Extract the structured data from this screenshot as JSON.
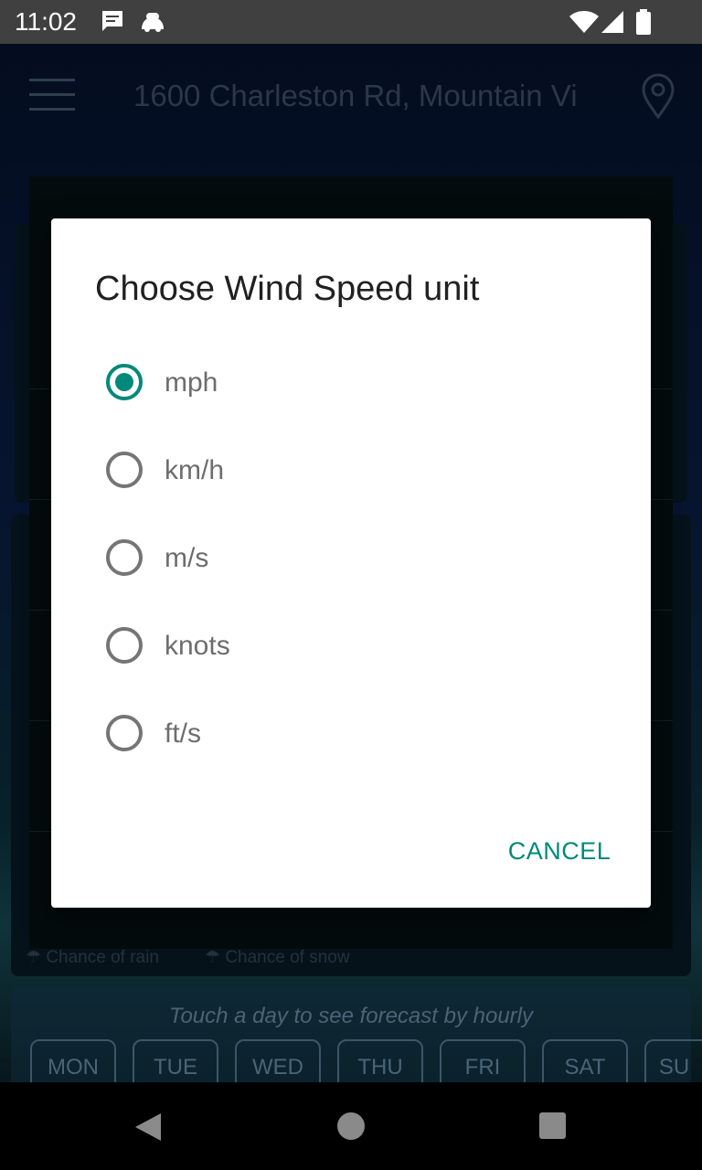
{
  "status_bar": {
    "time": "11:02",
    "icons": [
      "message-icon",
      "android-icon",
      "wifi-icon",
      "signal-icon",
      "battery-icon"
    ]
  },
  "header": {
    "location": "1600 Charleston Rd, Mountain Vi",
    "menu_icon": "hamburger-menu-icon",
    "location_icon": "map-pin-icon"
  },
  "background": {
    "legend": {
      "rain": "Chance of rain",
      "snow": "Chance of snow"
    },
    "forecast_hint": "Touch a day to see forecast by hourly",
    "days": [
      "MON",
      "TUE",
      "WED",
      "THU",
      "FRI",
      "SAT",
      "SU"
    ]
  },
  "dialog": {
    "title": "Choose Wind Speed unit",
    "options": [
      {
        "label": "mph",
        "selected": true
      },
      {
        "label": "km/h",
        "selected": false
      },
      {
        "label": "m/s",
        "selected": false
      },
      {
        "label": "knots",
        "selected": false
      },
      {
        "label": "ft/s",
        "selected": false
      }
    ],
    "cancel_label": "CANCEL",
    "accent_color": "#00897b"
  },
  "nav_bar": {
    "icons": [
      "back-icon",
      "home-icon",
      "recents-icon"
    ]
  }
}
